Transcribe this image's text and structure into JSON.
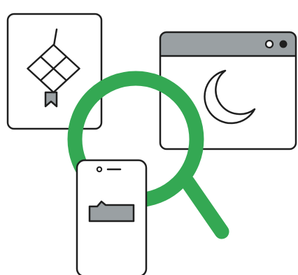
{
  "illustration": {
    "icons": [
      "ketupat-icon",
      "browser-window-icon",
      "crescent-moon-icon",
      "magnifying-glass-icon",
      "smartphone-icon",
      "folder-icon"
    ],
    "colors": {
      "magnifier": "#34a853",
      "outline": "#1f1f1f",
      "gray_fill": "#9aa0a3",
      "background": "#ffffff"
    }
  }
}
